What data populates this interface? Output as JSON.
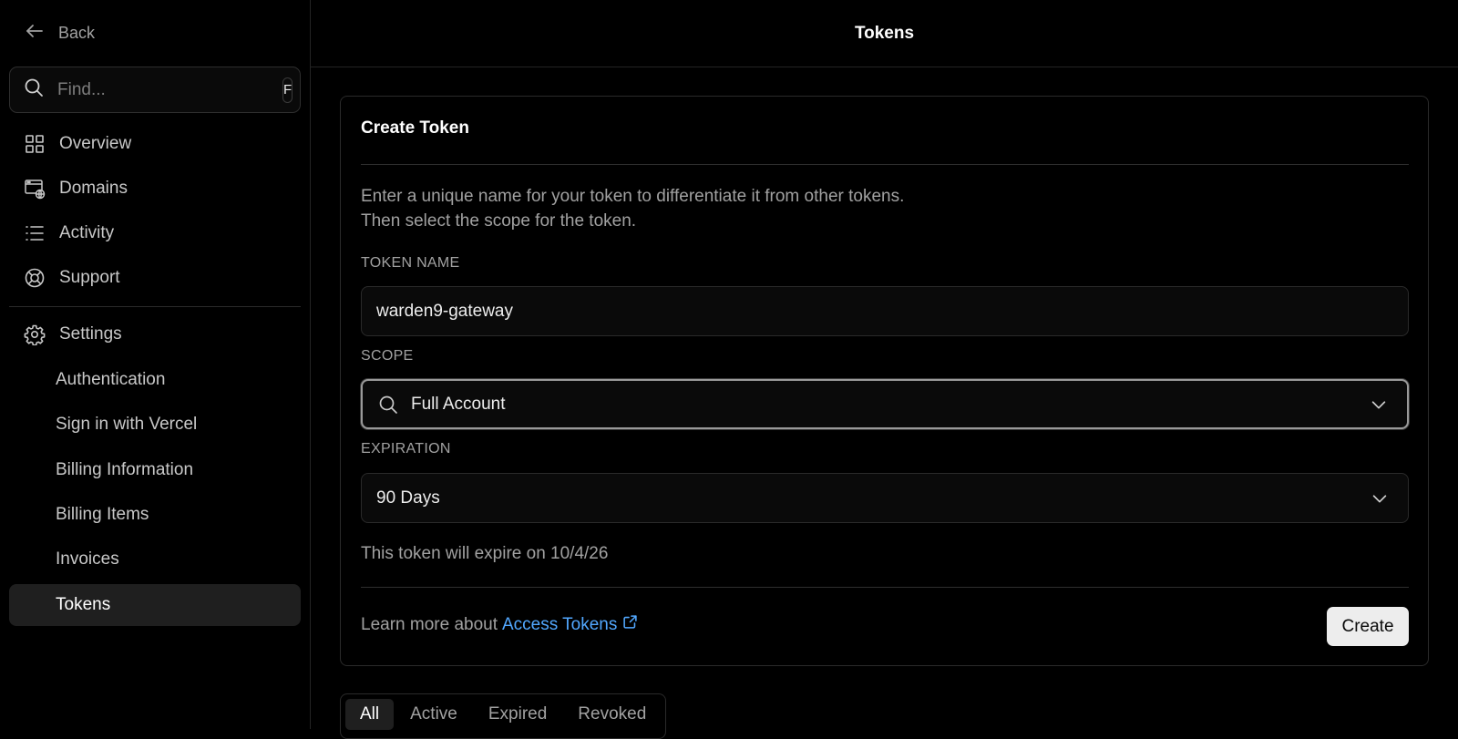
{
  "sidebar": {
    "back_label": "Back",
    "search": {
      "placeholder": "Find...",
      "shortcut": "F"
    },
    "items": [
      {
        "label": "Overview",
        "icon": "grid-icon"
      },
      {
        "label": "Domains",
        "icon": "globe-window-icon"
      },
      {
        "label": "Activity",
        "icon": "list-icon"
      },
      {
        "label": "Support",
        "icon": "lifebuoy-icon"
      },
      {
        "label": "Settings",
        "icon": "gear-icon"
      }
    ],
    "settings_items": [
      {
        "label": "Authentication"
      },
      {
        "label": "Sign in with Vercel"
      },
      {
        "label": "Billing Information"
      },
      {
        "label": "Billing Items"
      },
      {
        "label": "Invoices"
      },
      {
        "label": "Tokens",
        "active": true
      }
    ]
  },
  "header": {
    "title": "Tokens"
  },
  "create_token": {
    "title": "Create Token",
    "description_line1": "Enter a unique name for your token to differentiate it from other tokens.",
    "description_line2": "Then select the scope for the token.",
    "name_label": "TOKEN NAME",
    "name_value": "warden9-gateway",
    "scope_label": "SCOPE",
    "scope_value": "Full Account",
    "expiration_label": "EXPIRATION",
    "expiration_value": "90 Days",
    "expire_note": "This token will expire on 10/4/26",
    "learn_prefix": "Learn more about",
    "learn_link": "Access Tokens",
    "create_label": "Create"
  },
  "tabs": [
    {
      "label": "All",
      "active": true
    },
    {
      "label": "Active"
    },
    {
      "label": "Expired"
    },
    {
      "label": "Revoked"
    }
  ],
  "colors": {
    "background": "#000000",
    "link": "#52a8ff",
    "active_bg": "#1f1f1f",
    "button_bg": "#ededed"
  }
}
